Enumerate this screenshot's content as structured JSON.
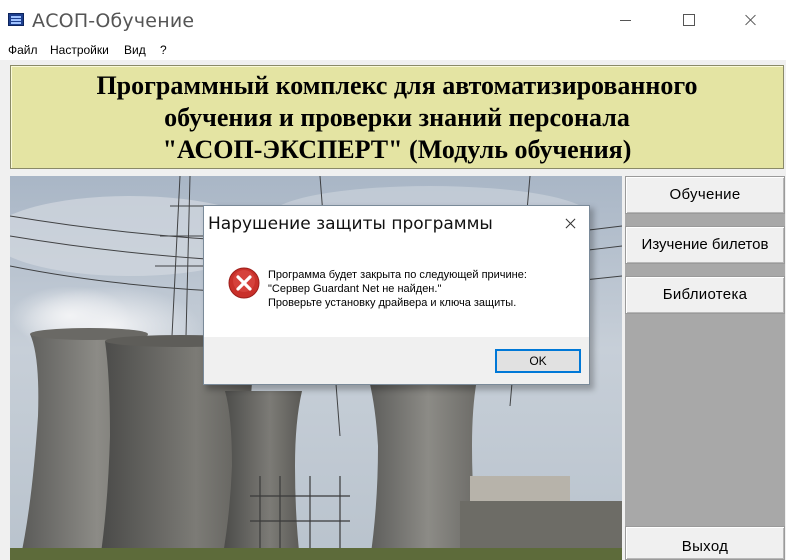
{
  "window": {
    "title": "АСОП-Обучение"
  },
  "menu": {
    "items": [
      "Файл",
      "Настройки",
      "Вид",
      "?"
    ]
  },
  "header": {
    "line1": "Программный комплекс для автоматизированного",
    "line2": "обучения и проверки знаний персонала",
    "line3": "\"АСОП-ЭКСПЕРТ\" (Модуль обучения)"
  },
  "side_buttons": {
    "training": "Обучение",
    "tickets": "Изучение билетов",
    "library": "Библиотека",
    "exit": "Выход"
  },
  "dialog": {
    "title": "Нарушение защиты программы",
    "icon": "error-icon",
    "message_line1": "Программа будет закрыта по следующей причине:",
    "message_line2": "\"Сервер Guardant Net не найден.\"",
    "message_line3": "Проверьте установку драйвера и ключа защиты.",
    "ok_label": "OK"
  },
  "colors": {
    "header_bg": "#e4e4a3",
    "accent": "#0078d7",
    "error_red": "#d9302c"
  }
}
